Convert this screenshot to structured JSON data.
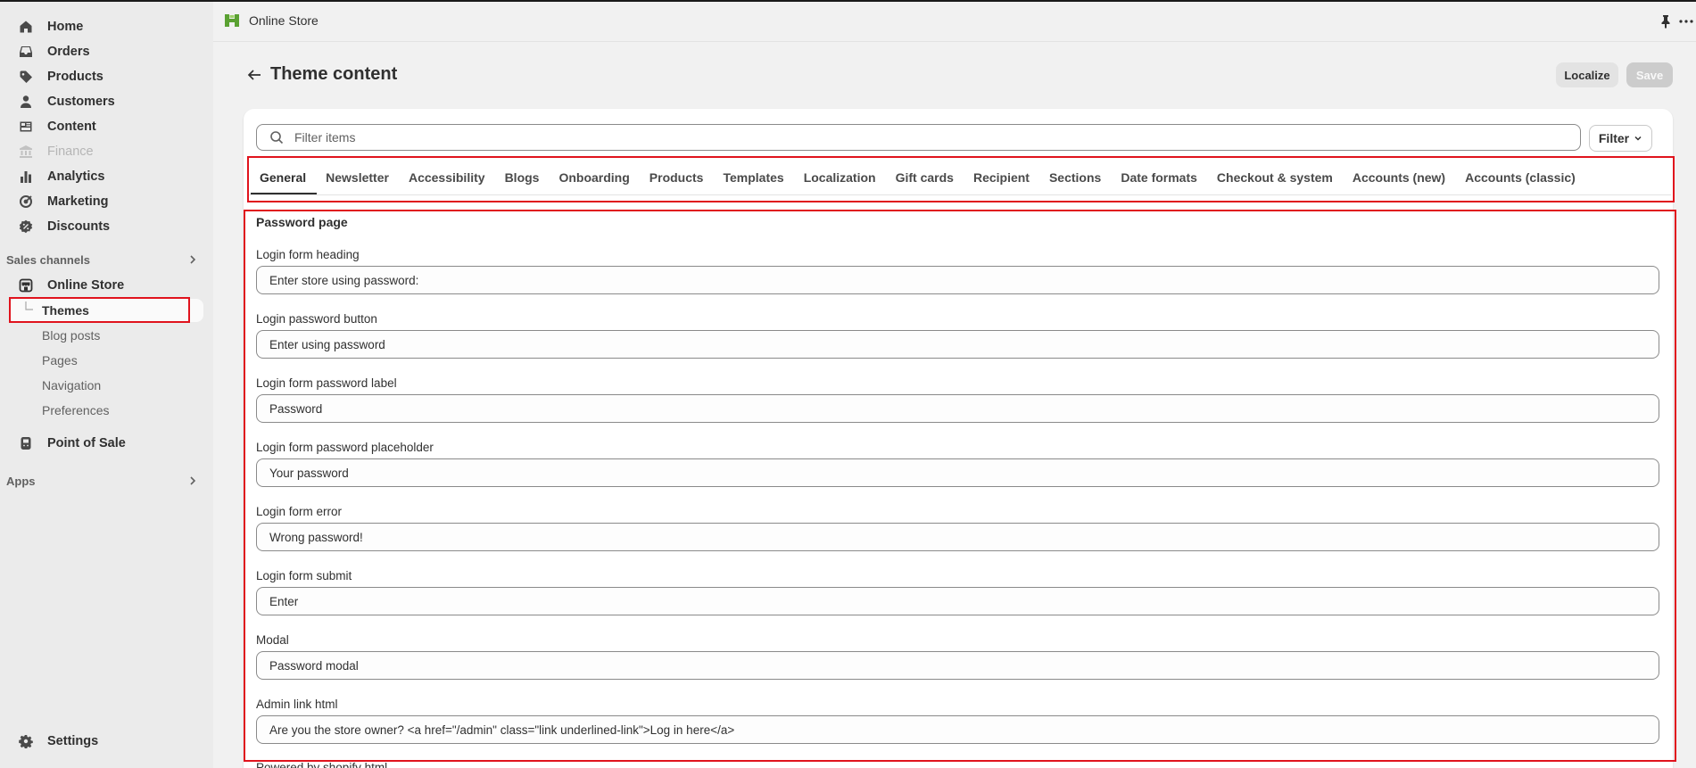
{
  "sidebar": {
    "items": [
      {
        "label": "Home",
        "icon": "home-icon"
      },
      {
        "label": "Orders",
        "icon": "orders-icon"
      },
      {
        "label": "Products",
        "icon": "tag-icon"
      },
      {
        "label": "Customers",
        "icon": "person-icon"
      },
      {
        "label": "Content",
        "icon": "content-icon"
      },
      {
        "label": "Finance",
        "icon": "bank-icon",
        "disabled": true
      },
      {
        "label": "Analytics",
        "icon": "bar-chart-icon"
      },
      {
        "label": "Marketing",
        "icon": "target-icon"
      },
      {
        "label": "Discounts",
        "icon": "discount-icon"
      }
    ],
    "sales_channels_label": "Sales channels",
    "online_store_label": "Online Store",
    "sub_items": [
      "Themes",
      "Blog posts",
      "Pages",
      "Navigation",
      "Preferences"
    ],
    "active_sub_item": "Themes",
    "pos_label": "Point of Sale",
    "apps_label": "Apps",
    "settings_label": "Settings"
  },
  "topbar": {
    "store_name": "Online Store"
  },
  "header": {
    "title": "Theme content",
    "localize_label": "Localize",
    "save_label": "Save"
  },
  "search": {
    "placeholder": "Filter items",
    "filter_label": "Filter"
  },
  "tabs": [
    "General",
    "Newsletter",
    "Accessibility",
    "Blogs",
    "Onboarding",
    "Products",
    "Templates",
    "Localization",
    "Gift cards",
    "Recipient",
    "Sections",
    "Date formats",
    "Checkout & system",
    "Accounts (new)",
    "Accounts (classic)"
  ],
  "active_tab": "General",
  "form": {
    "section_title": "Password page",
    "fields": [
      {
        "label": "Login form heading",
        "value": "Enter store using password:"
      },
      {
        "label": "Login password button",
        "value": "Enter using password"
      },
      {
        "label": "Login form password label",
        "value": "Password"
      },
      {
        "label": "Login form password placeholder",
        "value": "Your password"
      },
      {
        "label": "Login form error",
        "value": "Wrong password!"
      },
      {
        "label": "Login form submit",
        "value": "Enter"
      },
      {
        "label": "Modal",
        "value": "Password modal"
      },
      {
        "label": "Admin link html",
        "value": "Are you the store owner? <a href=\"/admin\" class=\"link underlined-link\">Log in here</a>"
      }
    ],
    "next_label_cut": "Powered by shopify html"
  },
  "colors": {
    "highlight": "#e0131d",
    "sidebar_bg": "#ebebeb",
    "page_bg": "#f1f1f1",
    "store_icon_green": "#5aa132"
  }
}
